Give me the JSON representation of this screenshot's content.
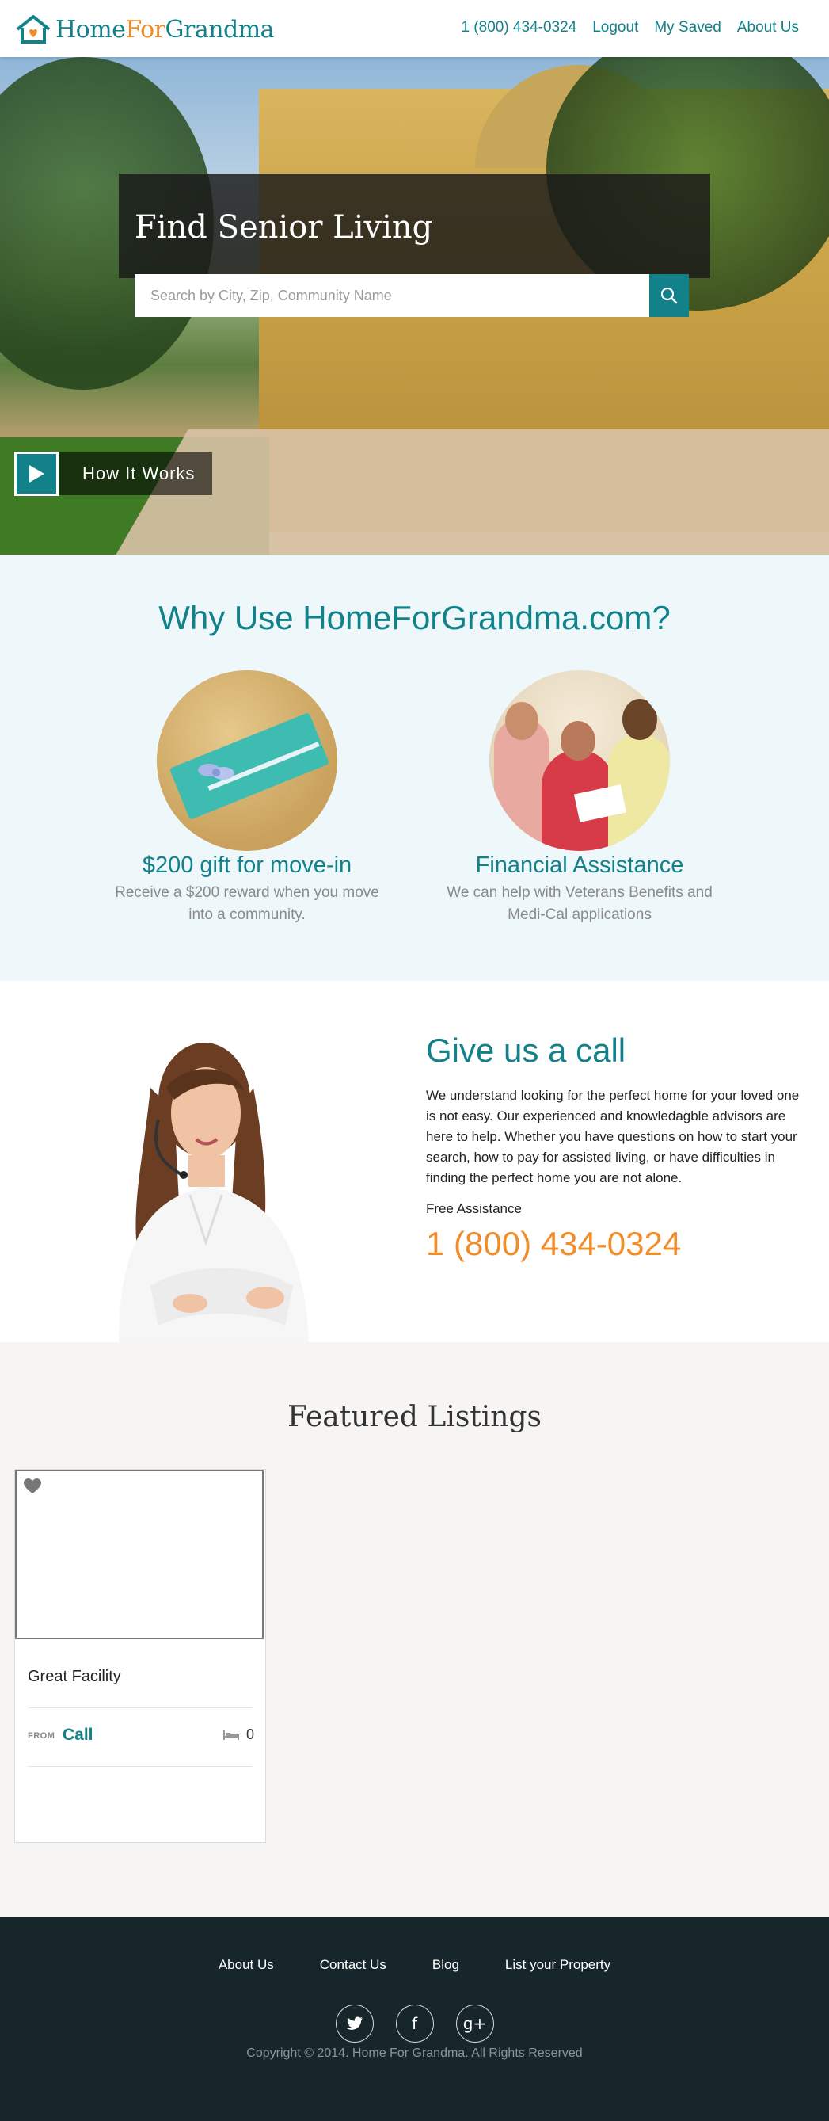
{
  "header": {
    "logo_home": "Home",
    "logo_for": "For",
    "logo_grandma": "Grandma",
    "nav": [
      "1 (800) 434-0324",
      "Logout",
      "My Saved",
      "About Us"
    ]
  },
  "hero": {
    "title": "Find Senior Living",
    "search_placeholder": "Search by City, Zip, Community Name",
    "how_it_works": "How It Works"
  },
  "why": {
    "title": "Why Use HomeForGrandma.com?",
    "items": [
      {
        "heading": "$200 gift for move-in",
        "desc": "Receive a $200 reward when you move into a community."
      },
      {
        "heading": "Financial Assistance",
        "desc": "We can help with Veterans Benefits and Medi-Cal applications"
      }
    ]
  },
  "call": {
    "title": "Give us a call",
    "text": "We understand looking for the perfect home for your loved one is not easy. Our experienced and knowledagble advisors are here to help. Whether you have questions on how to start your search, how to pay for assisted living, or have difficulties in finding the perfect home you are not alone.",
    "free_label": "Free Assistance",
    "phone": "1 (800) 434-0324"
  },
  "featured": {
    "title": "Featured Listings",
    "listings": [
      {
        "name": "Great Facility",
        "from_label": "FROM",
        "price": "Call",
        "beds": "0"
      }
    ]
  },
  "footer": {
    "links": [
      "About Us",
      "Contact Us",
      "Blog",
      "List your Property"
    ],
    "social": [
      "twitter-icon",
      "facebook-icon",
      "google-plus-icon"
    ],
    "social_glyphs": [
      "f",
      "g+"
    ],
    "copyright": "Copyright © 2014. Home For Grandma. All Rights Reserved"
  },
  "colors": {
    "teal": "#12818a",
    "orange": "#f08c2a",
    "footer_bg": "#16262a",
    "why_bg": "#eef8fb"
  }
}
